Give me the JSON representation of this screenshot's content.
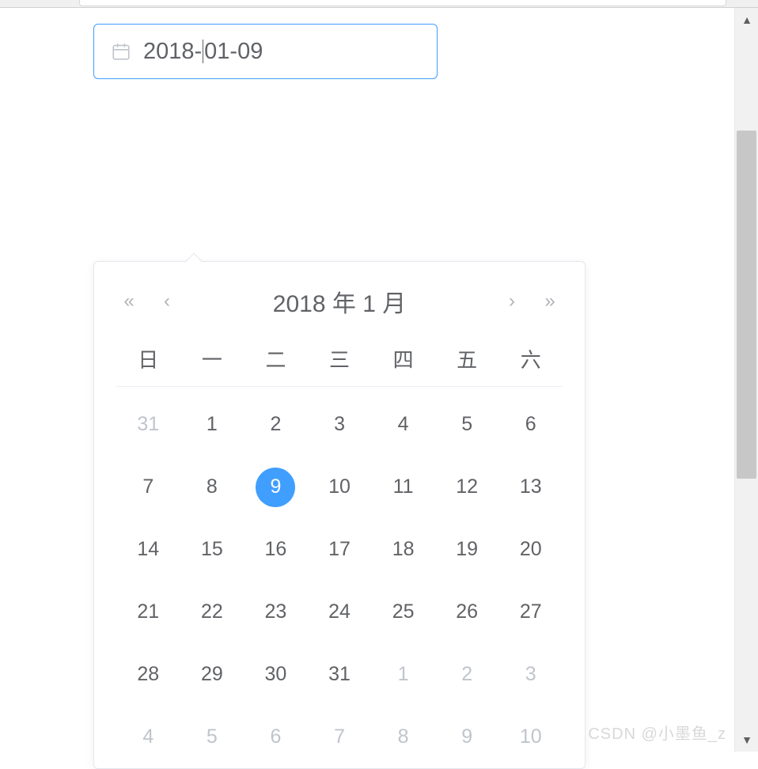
{
  "input": {
    "value_before_cursor": "2018-",
    "value_after_cursor": "01-09"
  },
  "picker": {
    "header_title": "2018 年  1 月",
    "weekdays": [
      "日",
      "一",
      "二",
      "三",
      "四",
      "五",
      "六"
    ],
    "weeks": [
      [
        {
          "d": "31",
          "muted": true
        },
        {
          "d": "1"
        },
        {
          "d": "2"
        },
        {
          "d": "3"
        },
        {
          "d": "4"
        },
        {
          "d": "5"
        },
        {
          "d": "6"
        }
      ],
      [
        {
          "d": "7"
        },
        {
          "d": "8"
        },
        {
          "d": "9",
          "selected": true
        },
        {
          "d": "10"
        },
        {
          "d": "11"
        },
        {
          "d": "12"
        },
        {
          "d": "13"
        }
      ],
      [
        {
          "d": "14"
        },
        {
          "d": "15"
        },
        {
          "d": "16"
        },
        {
          "d": "17"
        },
        {
          "d": "18"
        },
        {
          "d": "19"
        },
        {
          "d": "20"
        }
      ],
      [
        {
          "d": "21"
        },
        {
          "d": "22"
        },
        {
          "d": "23"
        },
        {
          "d": "24"
        },
        {
          "d": "25"
        },
        {
          "d": "26"
        },
        {
          "d": "27"
        }
      ],
      [
        {
          "d": "28"
        },
        {
          "d": "29"
        },
        {
          "d": "30"
        },
        {
          "d": "31"
        },
        {
          "d": "1",
          "muted": true
        },
        {
          "d": "2",
          "muted": true
        },
        {
          "d": "3",
          "muted": true
        }
      ],
      [
        {
          "d": "4",
          "muted": true
        },
        {
          "d": "5",
          "muted": true
        },
        {
          "d": "6",
          "muted": true
        },
        {
          "d": "7",
          "muted": true
        },
        {
          "d": "8",
          "muted": true
        },
        {
          "d": "9",
          "muted": true
        },
        {
          "d": "10",
          "muted": true
        }
      ]
    ]
  },
  "nav": {
    "prev_year": "«",
    "prev_month": "‹",
    "next_month": "›",
    "next_year": "»"
  },
  "scroll": {
    "up": "▲",
    "down": "▼"
  },
  "watermark": "CSDN @小墨鱼_z"
}
